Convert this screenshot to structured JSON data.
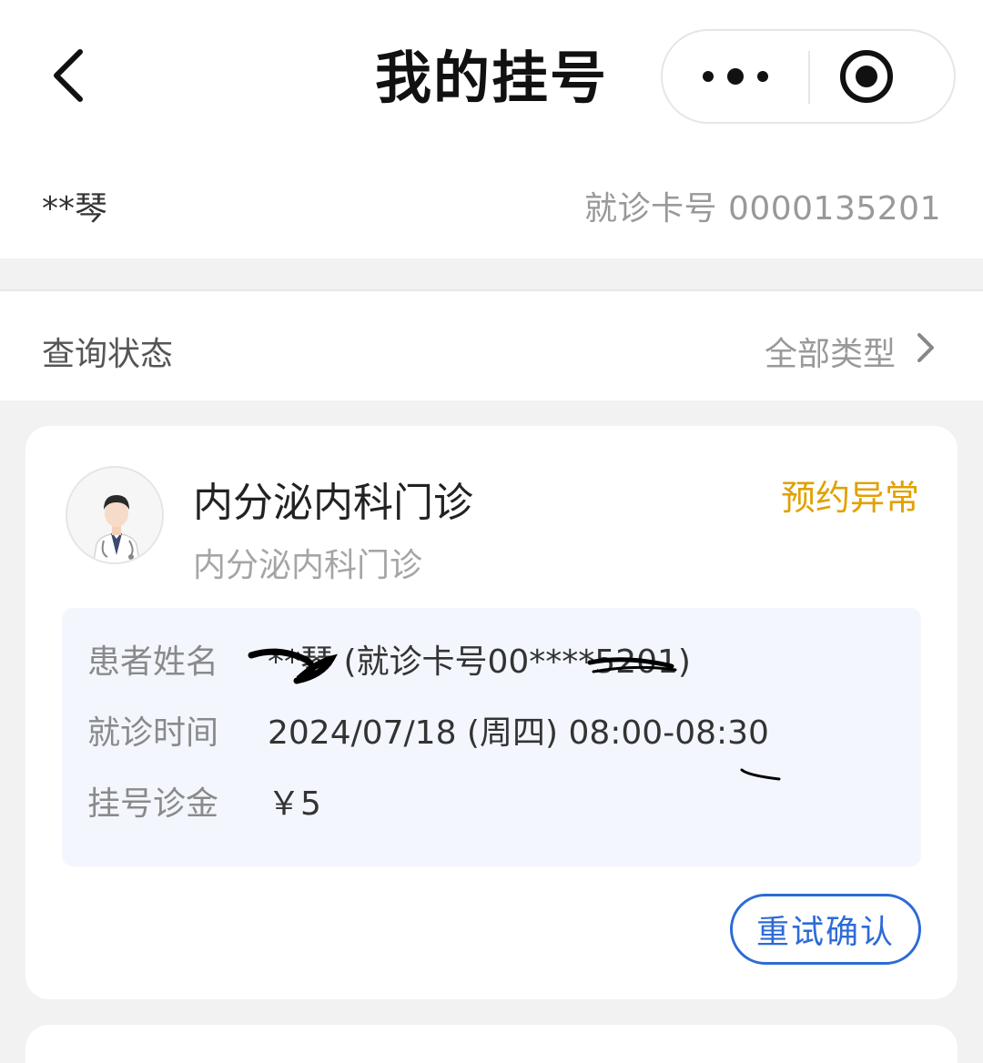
{
  "navbar": {
    "title": "我的挂号",
    "back_icon": "chevron-left-icon",
    "more_icon": "more-dots-icon",
    "target_icon": "target-circle-icon"
  },
  "patient": {
    "name": "**琴",
    "card_number_label": "就诊卡号 0000135201"
  },
  "filter": {
    "label": "查询状态",
    "value": "全部类型"
  },
  "record": {
    "department": "内分泌内科门诊",
    "sub_department": "内分泌内科门诊",
    "status": "预约异常",
    "status_color": "#e0a100",
    "fields": [
      {
        "label": "患者姓名",
        "value": "**琴 (就诊卡号00****5201)"
      },
      {
        "label": "就诊时间",
        "value": "2024/07/18 (周四) 08:00-08:30"
      },
      {
        "label": "挂号诊金",
        "value": "￥5"
      }
    ],
    "retry_button": "重试确认",
    "accent_color": "#2d6bd6"
  }
}
